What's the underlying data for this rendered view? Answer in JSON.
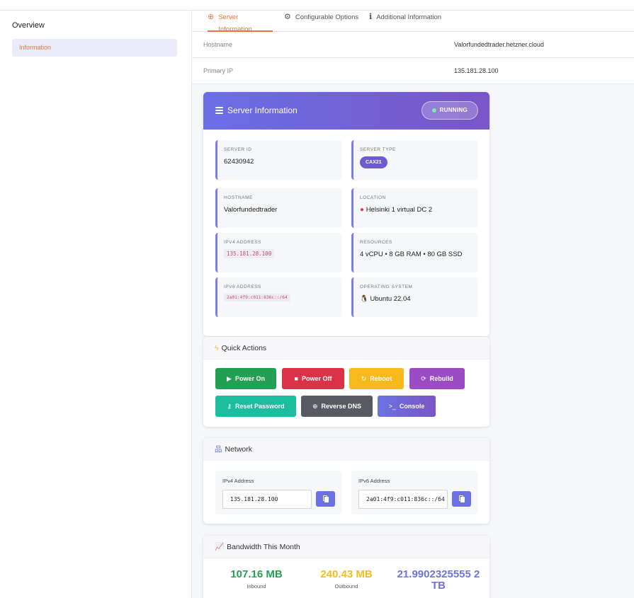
{
  "sidebar": {
    "heading": "Overview",
    "items": [
      {
        "label": "Information"
      }
    ]
  },
  "tabs": [
    {
      "label": "Server Information",
      "icon": "globe-icon",
      "active": true
    },
    {
      "label": "Configurable Options",
      "icon": "cogs-icon",
      "active": false
    },
    {
      "label": "Additional Information",
      "icon": "info-icon",
      "active": false
    }
  ],
  "info_rows": [
    {
      "label": "Hostname",
      "value": "Valorfundedtrader.hetzner.cloud"
    },
    {
      "label": "Primary IP",
      "value": "135.181.28.100"
    }
  ],
  "server_info": {
    "title": "Server Information",
    "status": "RUNNING",
    "fields": {
      "server_id": {
        "label": "SERVER ID",
        "value": "62430942"
      },
      "server_type": {
        "label": "SERVER TYPE",
        "value": "CAX21"
      },
      "hostname": {
        "label": "HOSTNAME",
        "value": "Valorfundedtrader"
      },
      "location": {
        "label": "LOCATION",
        "value": "Helsinki 1 virtual DC 2"
      },
      "ipv4": {
        "label": "IPV4 ADDRESS",
        "value": "135.181.28.100"
      },
      "resources": {
        "label": "RESOURCES",
        "value": "4 vCPU • 8 GB RAM • 80 GB SSD"
      },
      "ipv6": {
        "label": "IPV6 ADDRESS",
        "value": "2a01:4f9:c011:836c::/64"
      },
      "os": {
        "label": "OPERATING SYSTEM",
        "value": "Ubuntu 22.04"
      }
    }
  },
  "quick_actions": {
    "title": "Quick Actions",
    "buttons": [
      {
        "label": "Power On",
        "color": "#22a154"
      },
      {
        "label": "Power Off",
        "color": "#dc3247"
      },
      {
        "label": "Reboot",
        "color": "#f8b91c"
      },
      {
        "label": "Rebuild",
        "color": "#9b4cc4"
      },
      {
        "label": "Reset Password",
        "color": "#1dbd9f"
      },
      {
        "label": "Reverse DNS",
        "color": "#585c61"
      },
      {
        "label": "Console",
        "color": "#6e68d8"
      }
    ]
  },
  "network": {
    "title": "Network",
    "ipv4_label": "IPv4 Address",
    "ipv4_value": "135.181.28.100",
    "ipv6_label": "IPv6 Address",
    "ipv6_value": "2a01:4f9:c011:836c::/64"
  },
  "bandwidth": {
    "title": "Bandwidth This Month",
    "stats": [
      {
        "value": "107.16 MB",
        "label": "Inbound",
        "color": "#22a154"
      },
      {
        "value": "240.43 MB",
        "label": "Outbound",
        "color": "#f8b91c"
      },
      {
        "value": "21.9902325555 2 TB",
        "label": "",
        "color": "#6b73e2"
      }
    ]
  },
  "colors": {
    "accent": "#e8763a",
    "primary": "#6b73e2"
  }
}
